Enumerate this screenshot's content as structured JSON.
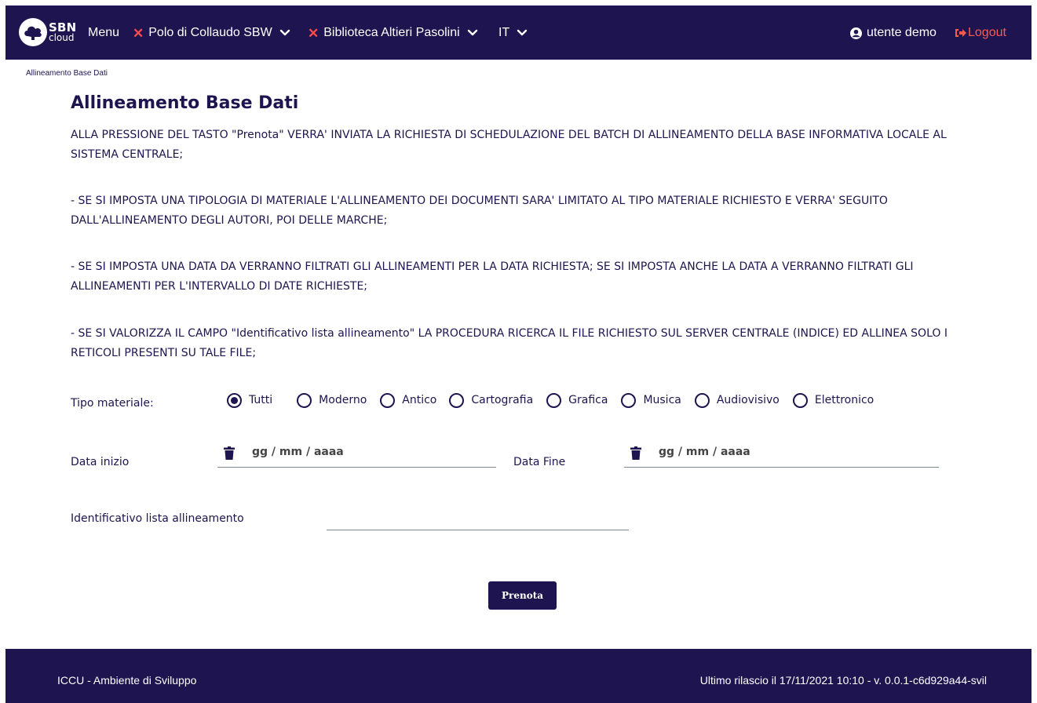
{
  "navbar": {
    "logo_sbn": "SBN",
    "logo_cloud": "cloud",
    "menu_label": "Menu",
    "polo_label": "Polo di Collaudo SBW",
    "biblioteca_label": "Biblioteca Altieri Pasolini",
    "language_label": "IT",
    "user_label": "utente demo",
    "logout_label": "Logout"
  },
  "breadcrumb": "Allineamento Base Dati",
  "page_title": "Allineamento Base Dati",
  "paragraphs": [
    "ALLA PRESSIONE DEL TASTO \"Prenota\" VERRA' INVIATA LA RICHIESTA DI SCHEDULAZIONE DEL BATCH DI ALLINEAMENTO DELLA BASE INFORMATIVA LOCALE AL SISTEMA CENTRALE;",
    "- SE SI IMPOSTA UNA TIPOLOGIA DI MATERIALE L'ALLINEAMENTO DEI DOCUMENTI SARA' LIMITATO AL TIPO MATERIALE RICHIESTO E VERRA' SEGUITO DALL'ALLINEAMENTO DEGLI AUTORI, POI DELLE MARCHE;",
    "- SE SI IMPOSTA UNA DATA DA VERRANNO FILTRATI GLI ALLINEAMENTI PER LA DATA RICHIESTA; SE SI IMPOSTA ANCHE LA DATA A VERRANNO FILTRATI GLI ALLINEAMENTI PER L'INTERVALLO DI DATE RICHIESTE;",
    "- SE SI VALORIZZA IL CAMPO \"Identificativo lista allineamento\" LA PROCEDURA RICERCA IL FILE RICHIESTO SUL SERVER CENTRALE (INDICE) ED ALLINEA SOLO I RETICOLI PRESENTI SU TALE FILE;"
  ],
  "form": {
    "tipo_materiale_label": "Tipo materiale:",
    "radio_options": [
      "Tutti",
      "Moderno",
      "Antico",
      "Cartografia",
      "Grafica",
      "Musica",
      "Audiovisivo",
      "Elettronico"
    ],
    "selected_option": "Tutti",
    "data_inizio_label": "Data inizio",
    "data_inizio_value": "gg / mm / aaaa",
    "data_fine_label": "Data Fine",
    "data_fine_value": "gg / mm / aaaa",
    "identificativo_label": "Identificativo lista allineamento",
    "identificativo_value": "",
    "submit_label": "Prenota"
  },
  "footer": {
    "left": "ICCU - Ambiente di Sviluppo",
    "right": "Ultimo rilascio il 17/11/2021 10:10 - v. 0.0.1-c6d929a44-svil"
  },
  "colors": {
    "primary": "#1e1450",
    "accent_red": "#ff4b4b",
    "logout": "#ff5a4a"
  }
}
